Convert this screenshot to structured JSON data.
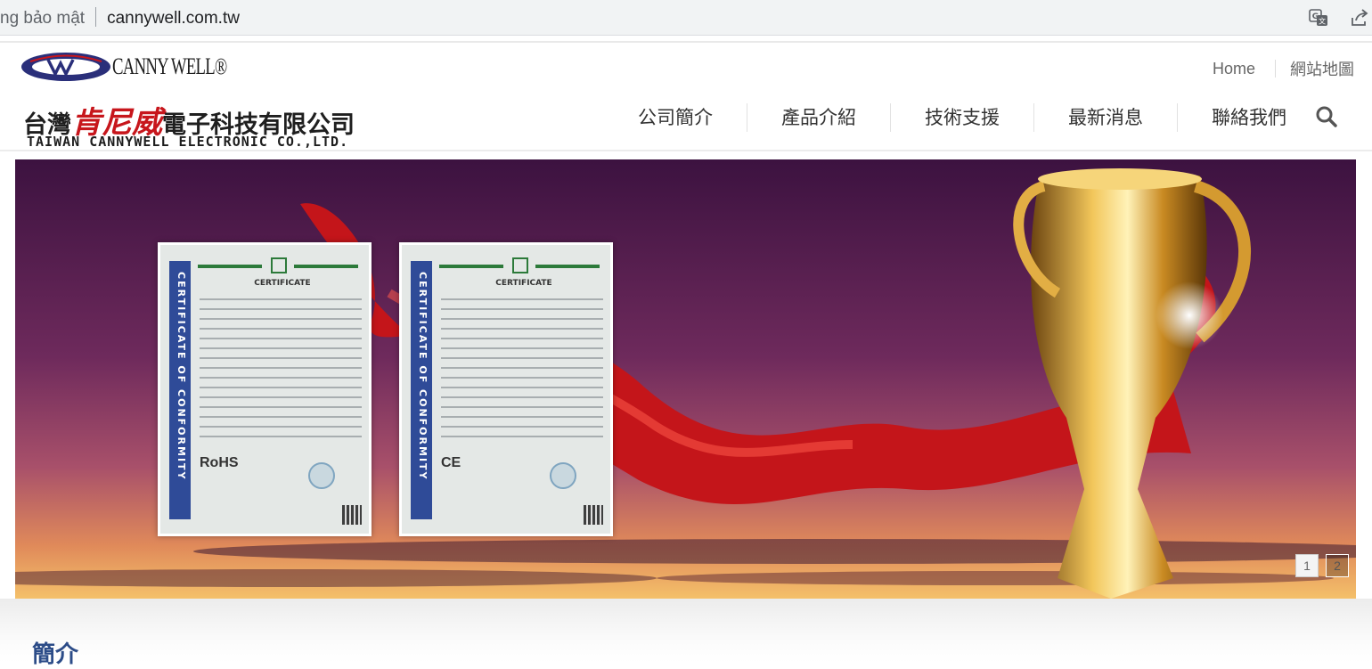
{
  "browser": {
    "security_text": "ng bảo mật",
    "url": "cannywell.com.tw",
    "icons": [
      "translate-icon",
      "share-icon"
    ]
  },
  "logo": {
    "brand": "CANNY WELL®",
    "chinese_part1": "台灣",
    "chinese_part2": "肯尼威",
    "chinese_part3": "電子科技有限公司",
    "english_name": "TAIWAN CANNYWELL ELECTRONIC CO.,LTD.",
    "colors": {
      "navy": "#2a2f7a",
      "red": "#c7161c"
    }
  },
  "toplinks": {
    "home": "Home",
    "sitemap": "網站地圖"
  },
  "nav": {
    "items": [
      "公司簡介",
      "產品介紹",
      "技術支援",
      "最新消息",
      "聯絡我們"
    ],
    "search_icon": "search-icon"
  },
  "banner": {
    "certificates": [
      {
        "side_text": "CERTIFICATE OF CONFORMITY",
        "title": "CERTIFICATE",
        "mark": "RoHS"
      },
      {
        "side_text": "CERTIFICATE OF CONFORMITY",
        "title": "CERTIFICATE",
        "mark": "CE"
      }
    ],
    "pager": [
      "1",
      "2"
    ],
    "active_page": "1"
  },
  "intro": {
    "title": "簡介",
    "color": "#2c4c88"
  }
}
